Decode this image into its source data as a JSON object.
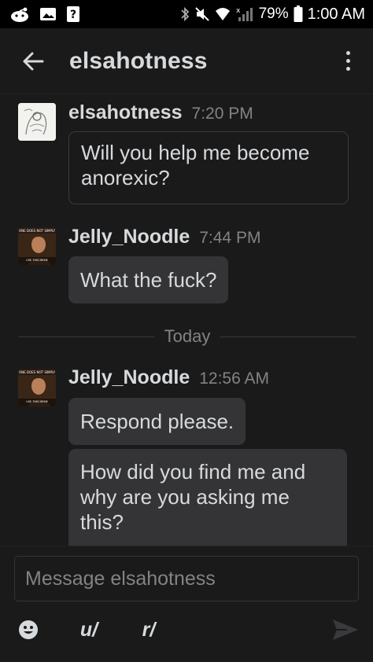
{
  "status_bar": {
    "battery_percent": "79%",
    "time": "1:00 AM",
    "signal_label": "x"
  },
  "header": {
    "title": "elsahotness",
    "back_icon": "arrow-left-icon",
    "menu_icon": "more-vertical-icon"
  },
  "messages": [
    {
      "author": "elsahotness",
      "time": "7:20 PM",
      "avatar": "sketch-avatar",
      "bubbles": [
        "Will you help me become\nanorexic?"
      ]
    },
    {
      "author": "Jelly_Noodle",
      "time": "7:44 PM",
      "avatar": "meme-avatar",
      "bubbles": [
        "What the fuck?"
      ]
    }
  ],
  "divider": {
    "label": "Today"
  },
  "messages_today": [
    {
      "author": "Jelly_Noodle",
      "time": "12:56 AM",
      "avatar": "meme-avatar",
      "bubbles": [
        "Respond please.",
        "How did you find me and\nwhy are you asking me\nthis?"
      ]
    }
  ],
  "composer": {
    "placeholder": "Message elsahotness",
    "user_button": "u/",
    "subreddit_button": "r/",
    "emoji_icon": "emoji-icon",
    "send_icon": "send-icon"
  },
  "colors": {
    "background": "#1a1a1b",
    "bubble_filled": "#343436",
    "bubble_border": "#3a3a3c",
    "text": "#d7dadc",
    "muted": "#818384"
  }
}
